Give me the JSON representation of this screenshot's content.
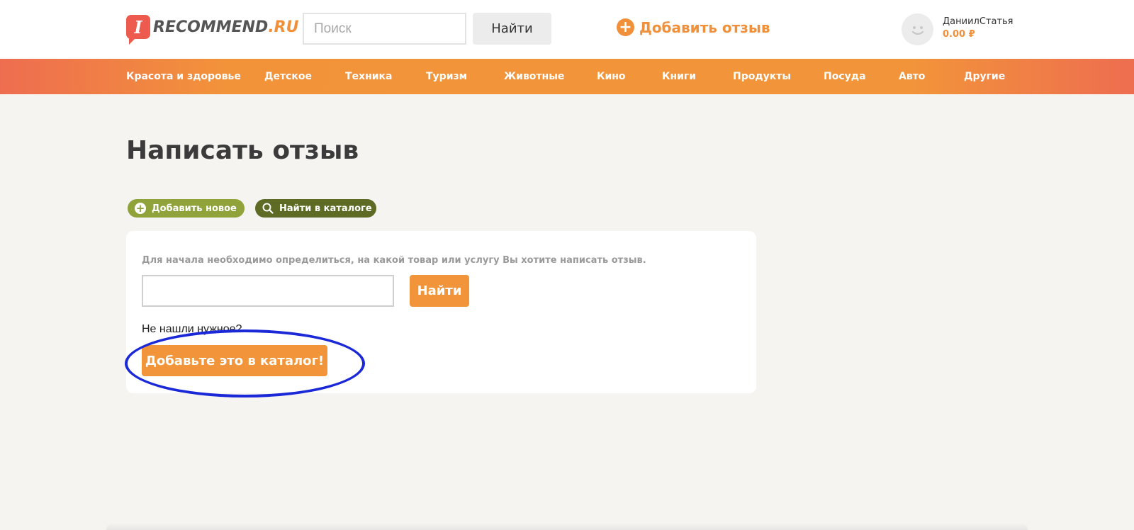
{
  "header": {
    "logo": {
      "badge": "I",
      "text": "RECOMMEND",
      "suffix": ".RU"
    },
    "search": {
      "placeholder": "Поиск",
      "value": "",
      "button_label": "Найти"
    },
    "add_review": {
      "label": "Добавить отзыв"
    },
    "user": {
      "name": "ДаниилСтатья",
      "balance": "0.00 ₽"
    }
  },
  "nav": {
    "items": [
      "Красота и здоровье",
      "Детское",
      "Техника",
      "Туризм",
      "Животные",
      "Кино",
      "Книги",
      "Продукты",
      "Посуда",
      "Авто",
      "Другие"
    ]
  },
  "main": {
    "title": "Написать отзыв",
    "pills": {
      "add_new": "Добавить новое",
      "find_in_catalog": "Найти в каталоге"
    },
    "card": {
      "hint": "Для начала необходимо определиться, на какой товар или услугу Вы хотите написать отзыв.",
      "input_value": "",
      "find_button": "Найти",
      "not_found": "Не нашли нужное?",
      "add_to_catalog_button": "Добавьте это в каталог!"
    }
  },
  "colors": {
    "accent": "#f2953a",
    "logo_red": "#ec5b4d",
    "pill_green": "#8fa33a",
    "pill_dark_green": "#5d6b24",
    "annotation_blue": "#1a28d8"
  }
}
